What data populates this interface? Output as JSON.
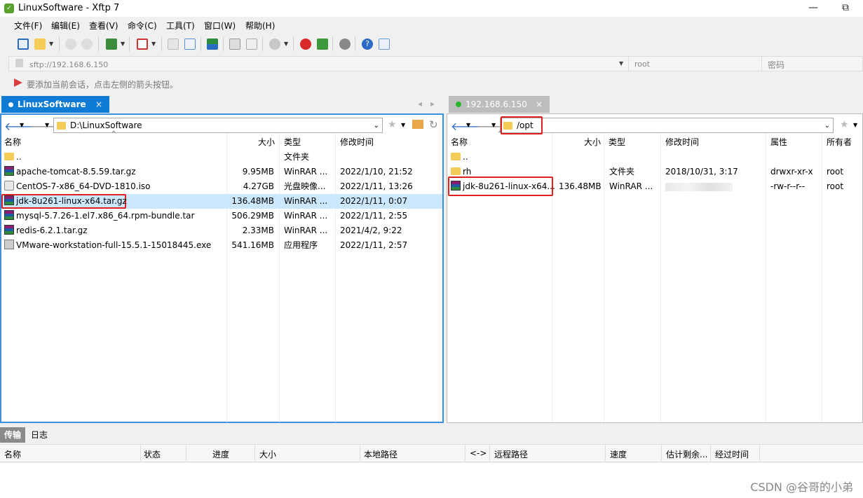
{
  "window": {
    "title": "LinuxSoftware - Xftp 7",
    "minimize_icon": "—",
    "maximize_icon": "⧉"
  },
  "menu": [
    "文件(F)",
    "编辑(E)",
    "查看(V)",
    "命令(C)",
    "工具(T)",
    "窗口(W)",
    "帮助(H)"
  ],
  "address_bar": {
    "url": "sftp://192.168.6.150",
    "user": "root",
    "password_placeholder": "密码"
  },
  "hint": "要添加当前会话，点击左侧的箭头按钮。",
  "tabs": {
    "local": "LinuxSoftware",
    "remote": "192.168.6.150",
    "close": "×"
  },
  "local": {
    "path": "D:\\LinuxSoftware",
    "columns": [
      "名称",
      "大小",
      "类型",
      "修改时间"
    ],
    "files": [
      {
        "name": "..",
        "size": "",
        "type": "文件夹",
        "modified": "",
        "icon": "folder"
      },
      {
        "name": "apache-tomcat-8.5.59.tar.gz",
        "size": "9.95MB",
        "type": "WinRAR ...",
        "modified": "2022/1/10, 21:52",
        "icon": "rar"
      },
      {
        "name": "CentOS-7-x86_64-DVD-1810.iso",
        "size": "4.27GB",
        "type": "光盘映像...",
        "modified": "2022/1/11, 13:26",
        "icon": "iso"
      },
      {
        "name": "jdk-8u261-linux-x64.tar.gz",
        "size": "136.48MB",
        "type": "WinRAR ...",
        "modified": "2022/1/11, 0:07",
        "icon": "rar"
      },
      {
        "name": "mysql-5.7.26-1.el7.x86_64.rpm-bundle.tar",
        "size": "506.29MB",
        "type": "WinRAR ...",
        "modified": "2022/1/11, 2:55",
        "icon": "rar"
      },
      {
        "name": "redis-6.2.1.tar.gz",
        "size": "2.33MB",
        "type": "WinRAR ...",
        "modified": "2021/4/2, 9:22",
        "icon": "rar"
      },
      {
        "name": "VMware-workstation-full-15.5.1-15018445.exe",
        "size": "541.16MB",
        "type": "应用程序",
        "modified": "2022/1/11, 2:57",
        "icon": "exe"
      }
    ]
  },
  "remote": {
    "path": "/opt",
    "columns": [
      "名称",
      "大小",
      "类型",
      "修改时间",
      "属性",
      "所有者"
    ],
    "files": [
      {
        "name": "..",
        "size": "",
        "type": "",
        "modified": "",
        "attr": "",
        "owner": "",
        "icon": "folder"
      },
      {
        "name": "rh",
        "size": "",
        "type": "文件夹",
        "modified": "2018/10/31, 3:17",
        "attr": "drwxr-xr-x",
        "owner": "root",
        "icon": "folder"
      },
      {
        "name": "jdk-8u261-linux-x64...",
        "size": "136.48MB",
        "type": "WinRAR ...",
        "modified": "",
        "attr": "-rw-r--r--",
        "owner": "root",
        "icon": "rar"
      }
    ]
  },
  "bottom": {
    "tabs": [
      "传输",
      "日志"
    ],
    "columns": [
      "名称",
      "状态",
      "进度",
      "大小",
      "本地路径",
      "<->",
      "远程路径",
      "速度",
      "估计剩余...",
      "经过时间"
    ]
  },
  "watermark": "CSDN @谷哥的小弟"
}
